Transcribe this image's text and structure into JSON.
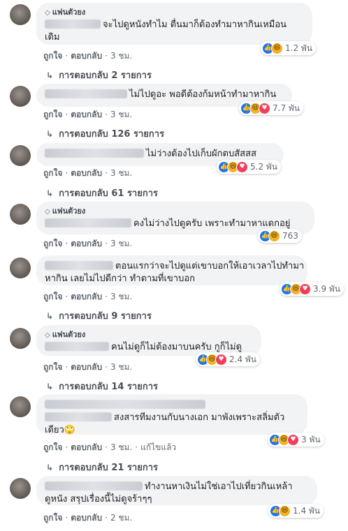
{
  "comments": [
    {
      "badge": "แฟนตัวยง",
      "lines": [
        "จะไปดูหนังทำไม ตื่นมาก็ต้องทำมาหากินเหมือน",
        "เดิม"
      ],
      "reactions": "1.2 พัน",
      "time": "3 ชม.",
      "replies": "การตอบกลับ 2 รายการ"
    },
    {
      "badge": "",
      "lines": [
        "ไม่ไปดูอะ พอดีต้องก้มหน้าทำมาหากิน"
      ],
      "reactions": "7.7 พัน",
      "time": "3 ชม.",
      "replies": "การตอบกลับ 126 รายการ"
    },
    {
      "badge": "",
      "lines": [
        "ไม่ว่างต้องไปเก็บผักตบสัสสส"
      ],
      "reactions": "5.2 พัน",
      "time": "3 ชม.",
      "replies": "การตอบกลับ 61 รายการ"
    },
    {
      "badge": "แฟนตัวยง",
      "lines": [
        "คงไม่ว่างไปดูครับ เพราะทำมาหาแดกอยู่"
      ],
      "reactions": "763",
      "time": "3 ชม.",
      "replies": "การตอบกลับ 9 รายการ"
    },
    {
      "badge": "",
      "lines": [
        "ตอนแรกว่าจะไปดูแต่เขาบอกให้เอาเวลาไปทำมา",
        "หากิน เลยไม่ไปดีกว่า ทำตามที่เขาบอก"
      ],
      "reactions": "3.9 พัน",
      "time": "3 ชม.",
      "replies": "การตอบกลับ 9 รายการ"
    },
    {
      "badge": "แฟนตัวยง",
      "lines": [
        "คนไม่ดูก็ไม่ต้องมาบนครับ กูก็ไม่ดู"
      ],
      "reactions": "2.4 พัน",
      "time": "3 ชม.",
      "replies": "การตอบกลับ 14 รายการ"
    },
    {
      "badge": "",
      "lines": [
        "สงสารทีมงานกับนางเอก มาพังเพราะสลิ่มตัว",
        "เดียว🙄"
      ],
      "reactions": "3 พัน",
      "time": "3 ชม.",
      "edited": "แก้ไขแล้ว",
      "replies": "การตอบกลับ 21 รายการ"
    },
    {
      "badge": "",
      "lines": [
        "ทำงานหาเงินไม่ใช่เอาไปเที่ยวกินเหล้า",
        "ดูหนัง สรุปเรื่องนี้ไม่ดูจร้าๆๆ"
      ],
      "reactions": "1.4 พัน",
      "time": "2 ชม.",
      "replies": ""
    }
  ],
  "ui": {
    "like_label": "ถูกใจ",
    "reply_label": "ตอบกลับ",
    "dot": "·"
  },
  "icons": {
    "badge": "diamond-icon",
    "reply_arrow": "reply-arrow-icon",
    "like": "like-icon",
    "haha": "haha-icon",
    "love": "love-icon"
  },
  "colors": {
    "bubble": "#f2f3f5",
    "like": "#1877f2",
    "love": "#f33e58",
    "haha": "#f7b125",
    "meta": "#606770"
  }
}
